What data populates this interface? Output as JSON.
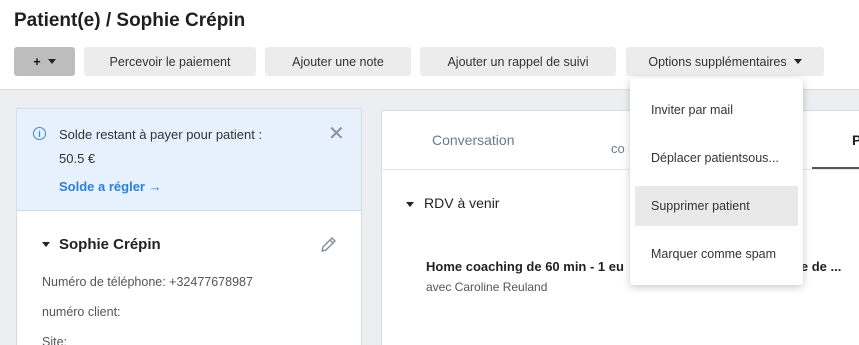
{
  "page": {
    "title": "Patient(e) / Sophie Crépin"
  },
  "toolbar": {
    "plus_label": "+",
    "payment_label": "Percevoir le paiement",
    "note_label": "Ajouter une note",
    "reminder_label": "Ajouter un rappel de suivi",
    "options_label": "Options supplémentaires"
  },
  "alert": {
    "text": "Solde restant à payer pour patient :",
    "amount": "50.5 €",
    "link": "Solde a régler →"
  },
  "patient": {
    "name": "Sophie Crépin",
    "phone": "Numéro de téléphone: +32477678987",
    "client_number": "numéro client:",
    "site": "Site:"
  },
  "tabs": {
    "conversation": "Conversation",
    "partial": "co",
    "partial_right": "P"
  },
  "rdv": {
    "title": "RDV à venir",
    "appointment_title": "Home coaching de 60 min - 1 eu",
    "appointment_title_right": "rise de ...",
    "appointment_sub": "avec Caroline Reuland"
  },
  "dropdown": {
    "items": [
      {
        "label": "Inviter par mail"
      },
      {
        "label": "Déplacer patientsous..."
      },
      {
        "label": "Supprimer patient"
      },
      {
        "label": "Marquer comme spam"
      }
    ]
  },
  "colors": {
    "accent": "#2f7fd4",
    "alert_bg": "#e6f1fd",
    "page_bg": "#eceef1"
  }
}
